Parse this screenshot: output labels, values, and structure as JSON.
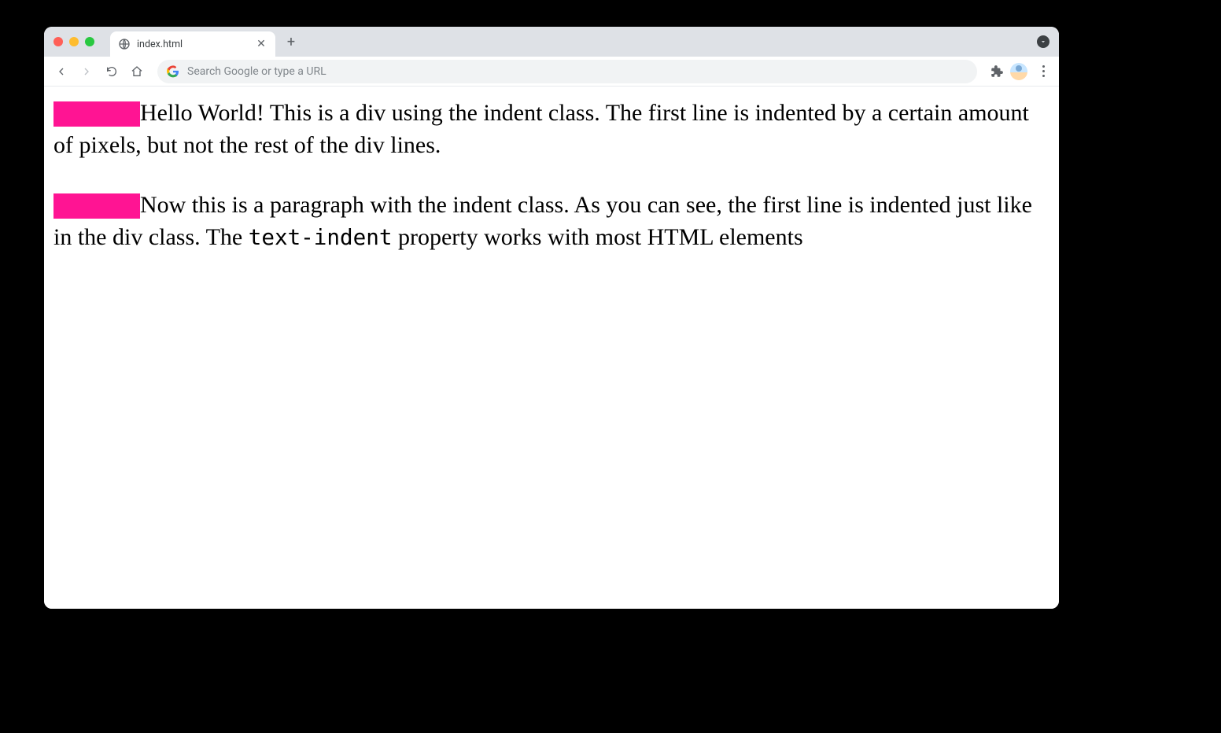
{
  "tab": {
    "title": "index.html"
  },
  "omnibox": {
    "placeholder": "Search Google or type a URL"
  },
  "page": {
    "block1_text": "Hello World! This is a div using the indent class. The first line is indented by a certain amount of pixels, but not the rest of the div lines.",
    "block2_text_part1": "Now this is a paragraph with the indent class. As you can see, the first line is indented just like in the div class. The ",
    "block2_code": "text-indent",
    "block2_text_part2": " property works with most HTML elements",
    "highlight_color": "#ff1493"
  }
}
